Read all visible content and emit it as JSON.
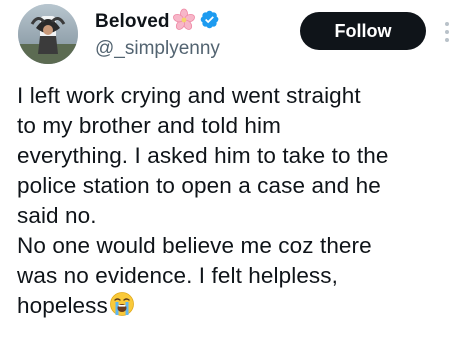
{
  "author": {
    "display_name": "Beloved",
    "handle": "@_simplyenny",
    "name_decoration_icon": "cherry-blossom-icon",
    "verified_icon": "verified-badge-icon",
    "verified_color": "#1d9bf0"
  },
  "actions": {
    "follow_label": "Follow",
    "more_icon": "more-options-icon"
  },
  "tweet": {
    "text": "I left work crying and went straight\nto my brother and told him\neverything. I asked him to take to the\npolice station to open a case and he\nsaid no.\nNo one would believe me coz there\nwas no evidence. I felt helpless,\nhopeless",
    "trailing_emoji": "loudly-crying-face-icon"
  },
  "colors": {
    "text": "#0f1419",
    "secondary_text": "#536471",
    "button_bg": "#0f1419",
    "button_text": "#ffffff"
  }
}
